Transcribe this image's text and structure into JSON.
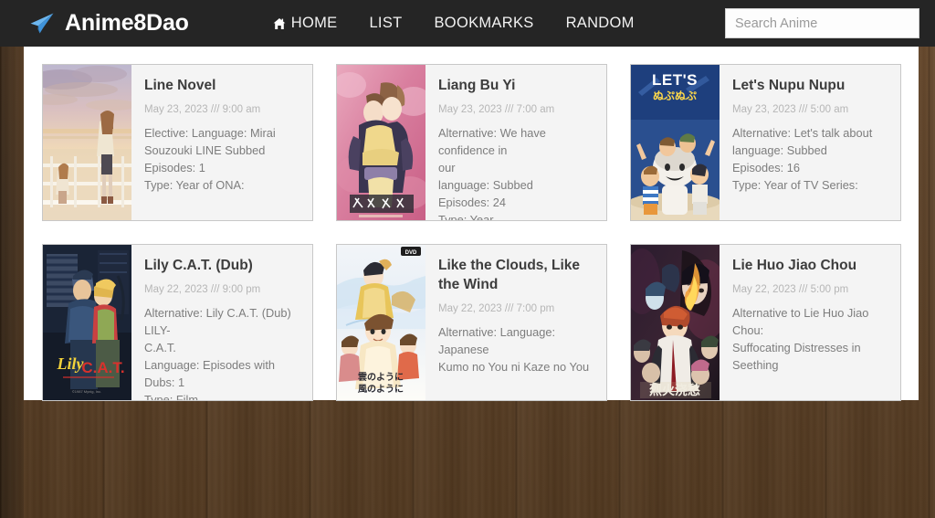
{
  "header": {
    "brand": "Anime8Dao",
    "brand_icon": "paper-plane-icon",
    "nav": [
      {
        "label": "HOME",
        "icon": "home-icon"
      },
      {
        "label": "LIST",
        "icon": null
      },
      {
        "label": "BOOKMARKS",
        "icon": null
      },
      {
        "label": "RANDOM",
        "icon": null
      }
    ],
    "search": {
      "placeholder": "Search Anime",
      "value": "",
      "icon": "search-icon"
    },
    "bg_color": "#252525"
  },
  "page": {
    "background_color": "#5b422a",
    "panel_color": "#ffffff"
  },
  "cards": [
    {
      "title": "Line Novel",
      "date": "May 23, 2023 /// 9:00 am",
      "description": "Elective: Language: Mirai\nSouzouki LINE Subbed\nEpisodes: 1\nType: Year of ONA:",
      "thumb": "sunset-walkway-poster"
    },
    {
      "title": "Liang Bu Yi",
      "date": "May 23, 2023 /// 7:00 am",
      "description": "Alternative: We have confidence in\nour\nlanguage: Subbed\nEpisodes: 24\nType: Year",
      "thumb": "pink-couple-poster"
    },
    {
      "title": "Let's Nupu Nupu",
      "date": "May 23, 2023 /// 5:00 am",
      "description": "Alternative: Let's talk about\nlanguage: Subbed\nEpisodes: 16\nType: Year of TV Series:",
      "thumb": "blue-lets-poster"
    },
    {
      "title": "Lily C.A.T. (Dub)",
      "date": "May 22, 2023 /// 9:00 pm",
      "description": "Alternative: Lily C.A.T. (Dub) LILY-\nC.A.T.\nLanguage: Episodes with Dubs: 1\nType: Film",
      "thumb": "lily-cat-poster"
    },
    {
      "title": "Like the Clouds, Like the Wind",
      "date": "May 22, 2023 /// 7:00 pm",
      "description": "Alternative: Language: Japanese\nKumo no You ni Kaze no You",
      "thumb": "clouds-wind-poster"
    },
    {
      "title": "Lie Huo Jiao Chou",
      "date": "May 22, 2023 /// 5:00 pm",
      "description": "Alternative to Lie Huo Jiao Chou:\nSuffocating Distresses in Seething",
      "thumb": "lie-huo-poster"
    }
  ]
}
